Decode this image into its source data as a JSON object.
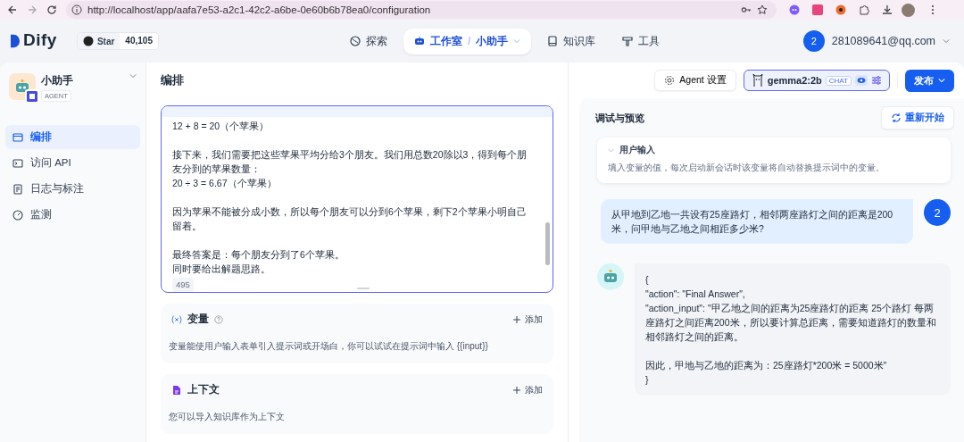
{
  "browser": {
    "url": "http://localhost/app/aafa7e53-a2c1-42c2-a6be-0e60b6b78ea0/configuration"
  },
  "header": {
    "logo": "Dify",
    "github": {
      "label": "Star",
      "count": "40,105"
    },
    "nav": [
      {
        "label": "探索",
        "selected": false
      },
      {
        "label": "工作室",
        "selected": true,
        "separator": "/",
        "sub": "小助手"
      },
      {
        "label": "知识库",
        "selected": false
      },
      {
        "label": "工具",
        "selected": false
      }
    ],
    "user": {
      "avatar": "2",
      "email": "281089641@qq.com"
    }
  },
  "sidebar": {
    "app_name": "小助手",
    "app_badge": "AGENT",
    "items": [
      {
        "label": "编排",
        "selected": true
      },
      {
        "label": "访问 API",
        "selected": false
      },
      {
        "label": "日志与标注",
        "selected": false
      },
      {
        "label": "监测",
        "selected": false
      }
    ]
  },
  "toolbar": {
    "title": "编排",
    "agent_button": "Agent 设置",
    "model": {
      "name": "gemma2:2b",
      "badge": "CHAT"
    },
    "publish": "发布"
  },
  "prompt": {
    "paragraphs": [
      [
        "12 + 8 = 20（个苹果）"
      ],
      [
        "接下来，我们需要把这些苹果平均分给3个朋友。我们用总数20除以3，得到每个朋友分到的苹果数量：",
        "20 ÷ 3 = 6.67（个苹果）"
      ],
      [
        "因为苹果不能被分成小数，所以每个朋友可以分到6个苹果，剩下2个苹果小明自己留着。"
      ],
      [
        "最终答案是：每个朋友分到了6个苹果。",
        "同时要给出解题思路。"
      ]
    ],
    "count": "495"
  },
  "sections": [
    {
      "kind": "variables",
      "title": "变量",
      "add": "添加",
      "description": "变量能使用户输入表单引入提示词或开场白，你可以试试在提示词中输入 {{input}}"
    },
    {
      "kind": "context",
      "title": "上下文",
      "add": "添加",
      "description": "您可以导入知识库作为上下文"
    }
  ],
  "debug": {
    "title": "调试与预览",
    "restart": "重新开始",
    "user_input": {
      "title": "用户输入",
      "description": "填入变量的值，每次启动新会话时该变量将自动替换提示词中的变量。"
    },
    "messages": [
      {
        "kind": "user",
        "avatar": "2",
        "paragraphs": [
          [
            "从甲地到乙地一共设有25座路灯，相邻两座路灯之间的距离是200米，问甲地与乙地之间相距多少米?"
          ]
        ]
      },
      {
        "kind": "bot",
        "paragraphs": [
          [
            "{",
            "\"action\": \"Final Answer\",",
            "\"action_input\": \"甲乙地之间的距离为25座路灯的距离 25个路灯 每两座路灯之间距离200米，所以要计算总距离，需要知道路灯的数量和相邻路灯之间的距离。"
          ],
          [
            "因此，甲地与乙地的距离为：25座路灯*200米 = 5000米\"",
            "}"
          ]
        ]
      }
    ]
  }
}
